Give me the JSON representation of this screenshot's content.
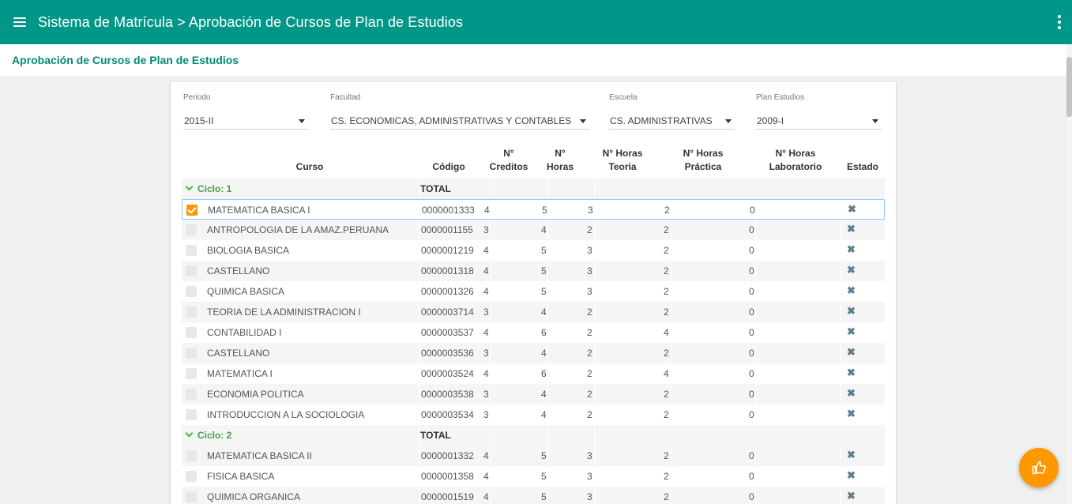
{
  "app": {
    "title": "Sistema de Matrícula > Aprobación de Cursos de Plan de Estudios"
  },
  "page": {
    "subtitle": "Aprobación de Cursos de Plan de Estudios"
  },
  "filters": {
    "periodo": {
      "label": "Periodo",
      "value": "2015-II"
    },
    "facultad": {
      "label": "Facultad",
      "value": "CS. ECONOMICAS, ADMINISTRATIVAS Y CONTABLES"
    },
    "escuela": {
      "label": "Escuela",
      "value": "CS. ADMINISTRATIVAS"
    },
    "plan": {
      "label": "Plan Estudios",
      "value": "2009-I"
    }
  },
  "table": {
    "headers": {
      "curso": "Curso",
      "codigo": "Código",
      "creditos_1": "N°",
      "creditos_2": "Creditos",
      "horas_1": "N°",
      "horas_2": "Horas",
      "teoria_1": "N° Horas",
      "teoria_2": "Teoria",
      "practica_1": "N° Horas",
      "practica_2": "Práctica",
      "lab_1": "N° Horas",
      "lab_2": "Laboratorio",
      "estado": "Estado"
    },
    "total_label": "TOTAL",
    "groups": [
      {
        "label": "Ciclo: 1",
        "rows": [
          {
            "curso": "MATEMATICA BASICA I",
            "codigo": "0000001333",
            "creditos": "4",
            "horas": "5",
            "teoria": "3",
            "practica": "2",
            "lab": "0",
            "checked": true
          },
          {
            "curso": "ANTROPOLOGIA DE LA AMAZ.PERUANA",
            "codigo": "0000001155",
            "creditos": "3",
            "horas": "4",
            "teoria": "2",
            "practica": "2",
            "lab": "0",
            "checked": false
          },
          {
            "curso": "BIOLOGIA BASICA",
            "codigo": "0000001219",
            "creditos": "4",
            "horas": "5",
            "teoria": "3",
            "practica": "2",
            "lab": "0",
            "checked": false
          },
          {
            "curso": "CASTELLANO",
            "codigo": "0000001318",
            "creditos": "4",
            "horas": "5",
            "teoria": "3",
            "practica": "2",
            "lab": "0",
            "checked": false
          },
          {
            "curso": "QUIMICA BASICA",
            "codigo": "0000001326",
            "creditos": "4",
            "horas": "5",
            "teoria": "3",
            "practica": "2",
            "lab": "0",
            "checked": false
          },
          {
            "curso": "TEORIA DE LA ADMINISTRACION I",
            "codigo": "0000003714",
            "creditos": "3",
            "horas": "4",
            "teoria": "2",
            "practica": "2",
            "lab": "0",
            "checked": false
          },
          {
            "curso": "CONTABILIDAD I",
            "codigo": "0000003537",
            "creditos": "4",
            "horas": "6",
            "teoria": "2",
            "practica": "4",
            "lab": "0",
            "checked": false
          },
          {
            "curso": "CASTELLANO",
            "codigo": "0000003536",
            "creditos": "3",
            "horas": "4",
            "teoria": "2",
            "practica": "2",
            "lab": "0",
            "checked": false
          },
          {
            "curso": "MATEMATICA I",
            "codigo": "0000003524",
            "creditos": "4",
            "horas": "6",
            "teoria": "2",
            "practica": "4",
            "lab": "0",
            "checked": false
          },
          {
            "curso": "ECONOMIA POLITICA",
            "codigo": "0000003538",
            "creditos": "3",
            "horas": "4",
            "teoria": "2",
            "practica": "2",
            "lab": "0",
            "checked": false
          },
          {
            "curso": "INTRODUCCION A LA SOCIOLOGIA",
            "codigo": "0000003534",
            "creditos": "3",
            "horas": "4",
            "teoria": "2",
            "practica": "2",
            "lab": "0",
            "checked": false
          }
        ]
      },
      {
        "label": "Ciclo: 2",
        "rows": [
          {
            "curso": "MATEMATICA BASICA II",
            "codigo": "0000001332",
            "creditos": "4",
            "horas": "5",
            "teoria": "3",
            "practica": "2",
            "lab": "0",
            "checked": false
          },
          {
            "curso": "FISICA BASICA",
            "codigo": "0000001358",
            "creditos": "4",
            "horas": "5",
            "teoria": "3",
            "practica": "2",
            "lab": "0",
            "checked": false
          },
          {
            "curso": "QUIMICA ORGANICA",
            "codigo": "0000001519",
            "creditos": "4",
            "horas": "5",
            "teoria": "3",
            "practica": "2",
            "lab": "0",
            "checked": false
          }
        ]
      }
    ],
    "estado_icon": "✖"
  },
  "icons": {
    "menu": "menu-icon",
    "more": "more-vert-icon",
    "fab": "thumb-up-icon",
    "estado": "close-icon"
  },
  "colors": {
    "primary": "#009688",
    "accent": "#ff9800",
    "group": "#43a047"
  }
}
